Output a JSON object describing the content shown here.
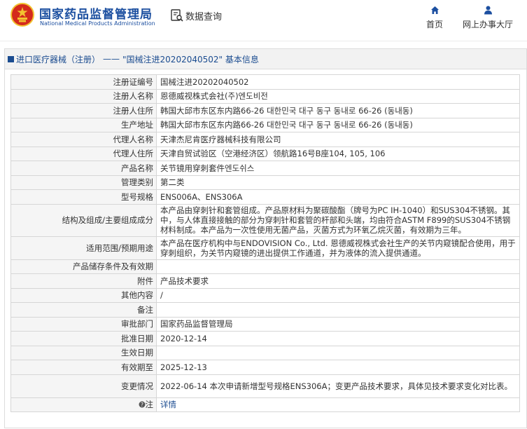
{
  "header": {
    "brand_cn": "国家药品监督管理局",
    "brand_en": "National Medical Products Administration",
    "search_label": "数据查询",
    "home_label": "首页",
    "service_label": "网上办事大厅"
  },
  "breadcrumb": {
    "category": "进口医疗器械（注册）",
    "separator": "——",
    "title": "\"国械注进20202040502\" 基本信息"
  },
  "rows": [
    {
      "label": "注册证编号",
      "value": "国械注进20202040502"
    },
    {
      "label": "注册人名称",
      "value": "恩德威视株式会社(주)엔도비전"
    },
    {
      "label": "注册人住所",
      "value": "韩国大邱市东区东内路66-26 대한민국 대구 동구 동내로 66-26 (동내동)"
    },
    {
      "label": "生产地址",
      "value": "韩国大邱市东区东内路66-26 대한민국 대구 동구 동내로 66-26 (동내동)"
    },
    {
      "label": "代理人名称",
      "value": "天津杰尼肯医疗器械科技有限公司"
    },
    {
      "label": "代理人住所",
      "value": "天津自贸试验区（空港经济区）领航路16号B座104, 105, 106"
    },
    {
      "label": "产品名称",
      "value": "关节镜用穿刺套件엔도쉬스"
    },
    {
      "label": "管理类别",
      "value": "第二类"
    },
    {
      "label": "型号规格",
      "value": "ENS006A、ENS306A"
    },
    {
      "label": "结构及组成/主要组成成分",
      "value": "本产品由穿刺针和套管组成。产品原材料为聚碳酸酯（牌号为PC IH-1040）和SUS304不锈钢。其中，与人体直接接触的部分为穿刺针和套管的杆部和头端，均由符合ASTM F899的SUS304不锈钢材料制成。本产品为一次性使用无菌产品，灭菌方式为环氧乙烷灭菌，有效期为三年。"
    },
    {
      "label": "适用范围/预期用途",
      "value": "本产品在医疗机构中与ENDOVISION Co., Ltd. 恩德威视株式会社生产的关节内窥镜配合使用，用于穿刺组织，为关节内窥镜的进出提供工作通道，并为液体的流入提供通道。"
    },
    {
      "label": "产品储存条件及有效期",
      "value": ""
    },
    {
      "label": "附件",
      "value": "产品技术要求"
    },
    {
      "label": "其他内容",
      "value": "/"
    },
    {
      "label": "备注",
      "value": ""
    },
    {
      "label": "审批部门",
      "value": "国家药品监督管理局"
    },
    {
      "label": "批准日期",
      "value": "2020-12-14"
    },
    {
      "label": "生效日期",
      "value": ""
    },
    {
      "label": "有效期至",
      "value": "2025-12-13"
    },
    {
      "label": "变更情况",
      "value": "2022-06-14 本次申请新增型号规格ENS306A；变更产品技术要求，具体见技术要求变化对比表。"
    }
  ],
  "note": {
    "label": "注",
    "link_text": "详情"
  },
  "colors": {
    "brand_blue": "#1c4fa0",
    "emblem_red": "#d42a1c",
    "emblem_gold": "#f2c230"
  },
  "icons": [
    "national-emblem-icon",
    "data-query-icon",
    "home-icon",
    "user-icon",
    "help-icon"
  ]
}
